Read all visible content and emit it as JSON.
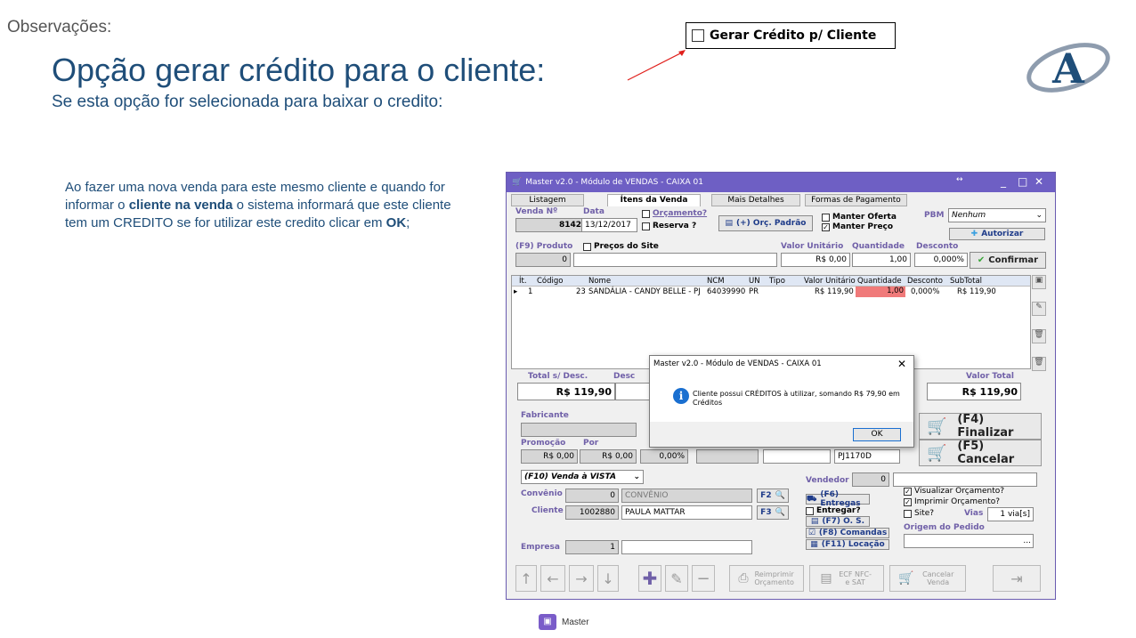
{
  "slide": {
    "observacoes": "Observações:",
    "title": "Opção gerar crédito para o cliente:",
    "subtitle": "Se esta opção for selecionada para baixar o credito:",
    "callout_label": "Gerar Crédito p/ Cliente",
    "desc_part1": "Ao fazer uma nova venda para este mesmo cliente e quando for informar o ",
    "desc_bold1": "cliente na venda",
    "desc_part2": " o sistema informará que este cliente tem um CREDITO se for utilizar este credito clicar em ",
    "desc_bold2": "OK",
    "desc_part3": ";",
    "logo_letter": "A"
  },
  "window": {
    "title": "Master v2.0 - Módulo de VENDAS - CAIXA 01",
    "tabs": [
      "Listagem",
      "Ítens da Venda",
      "Mais Detalhes",
      "Formas de Pagamento"
    ],
    "active_tab": "Ítens da Venda",
    "venda_label": "Venda Nº",
    "venda_value": "8142",
    "data_label": "Data",
    "data_value": "13/12/2017",
    "orcamento": "Orçamento?",
    "reserva": "Reserva ?",
    "orc_padrao": "(+) Orç. Padrão",
    "manter_oferta": "Manter Oferta",
    "manter_preco": "Manter Preço",
    "pbm_label": "PBM",
    "pbm_value": "Nenhum",
    "autorizar": "Autorizar",
    "produto_label": "(F9) Produto",
    "produto_value": "0",
    "precos_site": "Preços do Site",
    "valor_unit_label": "Valor Unitário",
    "valor_unit_value": "R$ 0,00",
    "quantidade_label": "Quantidade",
    "quantidade_value": "1,00",
    "desconto_label": "Desconto",
    "desconto_value": "0,000%",
    "confirmar": "Confirmar",
    "grid_headers": [
      "Ít.",
      "Código",
      "Nome",
      "NCM",
      "UN",
      "Tipo",
      "Valor Unitário",
      "Quantidade",
      "Desconto",
      "SubTotal"
    ],
    "grid_row": [
      "1",
      "23",
      "SANDÁLIA - CANDY BELLE - PJ",
      "64039990",
      "PR",
      "",
      "R$ 119,90",
      "1,00",
      "0,000%",
      "R$ 119,90"
    ],
    "total_sdesc_label": "Total s/ Desc.",
    "total_sdesc_value": "R$ 119,90",
    "desc_label": "Desc",
    "valor_total_label": "Valor Total",
    "valor_total_value": "R$ 119,90",
    "fabricante_label": "Fabricante",
    "promocao_label": "Promoção",
    "promocao_value": "R$ 0,00",
    "por_label": "Por",
    "por_value": "R$ 0,00",
    "pct_value": "0,00%",
    "ref_value": "PJ1170D",
    "finalizar": "(F4) Finalizar",
    "cancelar": "(F5) Cancelar",
    "venda_vista": "(F10) Venda à VISTA",
    "convenio_label": "Convênio",
    "convenio_code": "0",
    "convenio_name": "CONVÊNIO",
    "f2": "F2",
    "cliente_label": "Cliente",
    "cliente_code": "1002880",
    "cliente_name": "PAULA MATTAR",
    "f3": "F3",
    "empresa_label": "Empresa",
    "empresa_value": "1",
    "vendedor_label": "Vendedor",
    "vendedor_value": "0",
    "entregas": "(F6) Entregas",
    "entregar": "Entregar?",
    "os": "(F7)  O. S.",
    "comandas": "(F8) Comandas",
    "locacao": "(F11) Locação",
    "visualizar_orc": "Visualizar Orçamento?",
    "imprimir_orc": "Imprimir  Orçamento?",
    "site": "Site?",
    "vias_label": "Vias",
    "vias_value": "1 via[s]",
    "origem_label": "Origem do Pedido",
    "reimprimir": "Reimprimir Orçamento",
    "ecf": "ECF NFC-e SAT",
    "cancelar_venda": "Cancelar Venda"
  },
  "dialog": {
    "title": "Master v2.0 - Módulo de VENDAS - CAIXA 01",
    "message": "Cliente possui CRÉDITOS à utilizar, somando R$    79,90 em Créditos",
    "ok": "OK"
  },
  "footer": {
    "brand": "Master"
  },
  "colors": {
    "title_blue": "#1f4e79",
    "window_bar": "#6e5fc4",
    "label_purple": "#7060a8",
    "qty_highlight": "#f07a7a",
    "arrow": "#e0201c"
  }
}
